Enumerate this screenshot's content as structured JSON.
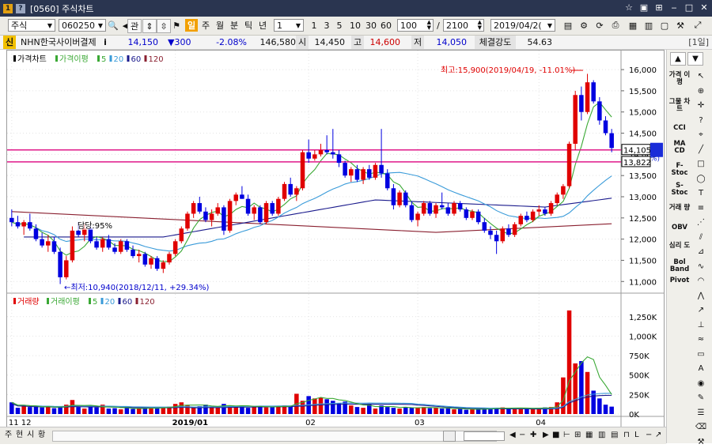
{
  "window": {
    "title": "[0560] 주식차트",
    "help_icon": "help-icon",
    "controls": [
      "fav-icon",
      "screen-icon",
      "link-icon",
      "minimize-icon",
      "maximize-icon",
      "close-icon"
    ]
  },
  "toolbar": {
    "market": "주식",
    "code": "060250",
    "buttons": [
      "관"
    ],
    "periods": [
      "일",
      "주",
      "월",
      "분",
      "틱",
      "년"
    ],
    "active_period": "일",
    "interval": "1",
    "quick_intervals": [
      "1",
      "3",
      "5",
      "10",
      "30",
      "60"
    ],
    "count": "100",
    "separator": "/",
    "total": "2100",
    "date": "2019/04/2("
  },
  "quote": {
    "badge": "신",
    "name": "NHN한국사이버결제",
    "info": "i",
    "price": "14,150",
    "change": "▼300",
    "change_pct": "-2.08%",
    "volume": "146,580",
    "open_label": "시",
    "open": "14,450",
    "high_label": "고",
    "high": "14,600",
    "low_label": "저",
    "low": "14,050",
    "strength_label": "체결강도",
    "strength": "54.63",
    "period_tag": "[1일]"
  },
  "price_legend": {
    "main": "가격차트",
    "ma": "가격이평",
    "p5": "5",
    "p20": "20",
    "p60": "60",
    "p120": "120"
  },
  "volume_legend": {
    "main": "거래량",
    "ma": "거래이평",
    "p5": "5",
    "p20": "20",
    "p60": "60",
    "p120": "120"
  },
  "annotations": {
    "max_label": "최고:15,900(2019/04/19, -11.01%)",
    "min_label": "최저:10,940(2018/12/11, +29.34%)",
    "mid_label": "담당:95%",
    "price_tag1": "14,105",
    "price_tag2": "13,822",
    "price_tag_extra": "%)"
  },
  "colors": {
    "up": "#e00000",
    "down": "#0000e0",
    "ma5": "#3aa834",
    "ma20": "#3a9bd9",
    "ma60": "#1a1a8c",
    "ma120": "#8a2030",
    "hline": "#e0188a"
  },
  "right_tools": {
    "labels": [
      "가격 이평",
      "그물 차트",
      "CCI",
      "MA CD",
      "F- Stoc",
      "S- Stoc",
      "거래 량",
      "OBV",
      "심리 도",
      "Bol Band",
      "Pivot"
    ]
  },
  "bottom": {
    "tabs": [
      "주",
      "현",
      "시",
      "황"
    ]
  },
  "chart_data": [
    {
      "type": "candlestick",
      "title": "가격차트",
      "x_axis_labels": [
        "11 12",
        "2019/01",
        "02",
        "03",
        "04"
      ],
      "y_ticks": [
        "16,000",
        "15,500",
        "15,000",
        "14,500",
        "14,000",
        "13,500",
        "13,000",
        "12,500",
        "12,000",
        "11,500",
        "11,000"
      ],
      "ylim": [
        10800,
        16300
      ],
      "horizontal_lines": [
        14105,
        13822
      ],
      "candles": [
        [
          12500,
          12700,
          12300,
          12400
        ],
        [
          12400,
          12550,
          12250,
          12300
        ],
        [
          12300,
          12450,
          12100,
          12400
        ],
        [
          12400,
          12600,
          12200,
          12250
        ],
        [
          12250,
          12350,
          11950,
          12000
        ],
        [
          12000,
          12150,
          11800,
          11850
        ],
        [
          11850,
          12100,
          11700,
          11950
        ],
        [
          11950,
          12050,
          11650,
          11700
        ],
        [
          11700,
          11800,
          10940,
          11100
        ],
        [
          11100,
          11600,
          11050,
          11500
        ],
        [
          11500,
          12300,
          11450,
          12200
        ],
        [
          12200,
          12400,
          12050,
          12100
        ],
        [
          12100,
          12350,
          11950,
          12250
        ],
        [
          12250,
          12300,
          11900,
          11950
        ],
        [
          11950,
          12050,
          11750,
          11800
        ],
        [
          11800,
          12050,
          11700,
          12000
        ],
        [
          12000,
          12100,
          11750,
          11800
        ],
        [
          11800,
          11900,
          11650,
          11700
        ],
        [
          11700,
          12000,
          11650,
          11950
        ],
        [
          11950,
          12000,
          11700,
          11750
        ],
        [
          11750,
          11850,
          11550,
          11600
        ],
        [
          11600,
          11750,
          11450,
          11650
        ],
        [
          11650,
          11700,
          11350,
          11400
        ],
        [
          11400,
          11600,
          11300,
          11550
        ],
        [
          11550,
          11600,
          11250,
          11300
        ],
        [
          11300,
          11500,
          11200,
          11450
        ],
        [
          11450,
          11700,
          11400,
          11650
        ],
        [
          11650,
          12000,
          11600,
          11950
        ],
        [
          11950,
          12300,
          11900,
          12250
        ],
        [
          12250,
          12650,
          12200,
          12600
        ],
        [
          12600,
          12900,
          12500,
          12850
        ],
        [
          12850,
          13000,
          12600,
          12650
        ],
        [
          12650,
          12750,
          12400,
          12450
        ],
        [
          12450,
          12700,
          12300,
          12600
        ],
        [
          12600,
          12850,
          12550,
          12750
        ],
        [
          12750,
          12800,
          12100,
          12200
        ],
        [
          12200,
          12950,
          12150,
          12900
        ],
        [
          12900,
          13100,
          12800,
          13050
        ],
        [
          13050,
          13250,
          12950,
          12950
        ],
        [
          12950,
          13050,
          12550,
          12600
        ],
        [
          12600,
          12800,
          12450,
          12750
        ],
        [
          12750,
          12800,
          12350,
          12400
        ],
        [
          12400,
          12900,
          12350,
          12850
        ],
        [
          12850,
          12900,
          12550,
          12600
        ],
        [
          12600,
          13000,
          12550,
          12950
        ],
        [
          12950,
          13350,
          12900,
          13300
        ],
        [
          13300,
          13450,
          13000,
          13050
        ],
        [
          13050,
          13250,
          12900,
          13200
        ],
        [
          13200,
          14100,
          13150,
          14050
        ],
        [
          14050,
          14350,
          13800,
          13900
        ],
        [
          13900,
          14100,
          13850,
          14000
        ],
        [
          14000,
          14250,
          13950,
          14100
        ],
        [
          14100,
          14450,
          14000,
          14050
        ],
        [
          14050,
          14600,
          13900,
          14000
        ],
        [
          14000,
          14100,
          13700,
          13800
        ],
        [
          13800,
          13850,
          13450,
          13500
        ],
        [
          13500,
          13700,
          13350,
          13650
        ],
        [
          13650,
          13750,
          13350,
          13400
        ],
        [
          13400,
          13700,
          13300,
          13650
        ],
        [
          13650,
          13750,
          13400,
          13450
        ],
        [
          13450,
          13800,
          13400,
          13750
        ],
        [
          13750,
          14600,
          13450,
          13550
        ],
        [
          13550,
          13650,
          13150,
          13200
        ],
        [
          13200,
          13300,
          12700,
          12800
        ],
        [
          12800,
          13150,
          12750,
          13100
        ],
        [
          13100,
          13150,
          12750,
          12800
        ],
        [
          12800,
          12900,
          12400,
          12450
        ],
        [
          12450,
          12650,
          12300,
          12600
        ],
        [
          12600,
          12900,
          12550,
          12850
        ],
        [
          12850,
          12900,
          12550,
          12600
        ],
        [
          12600,
          12850,
          12500,
          12800
        ],
        [
          12800,
          13100,
          12700,
          12750
        ],
        [
          12750,
          12850,
          12550,
          12600
        ],
        [
          12600,
          12900,
          12550,
          12850
        ],
        [
          12850,
          12900,
          12650,
          12700
        ],
        [
          12700,
          12750,
          12450,
          12500
        ],
        [
          12500,
          12700,
          12450,
          12650
        ],
        [
          12650,
          12700,
          12350,
          12400
        ],
        [
          12400,
          12500,
          12150,
          12200
        ],
        [
          12200,
          12300,
          12000,
          12100
        ],
        [
          12100,
          12200,
          11650,
          11950
        ],
        [
          11950,
          12300,
          11900,
          12250
        ],
        [
          12250,
          12350,
          12050,
          12100
        ],
        [
          12100,
          12400,
          12050,
          12350
        ],
        [
          12350,
          12600,
          12300,
          12550
        ],
        [
          12550,
          12650,
          12400,
          12450
        ],
        [
          12450,
          12700,
          12400,
          12650
        ],
        [
          12650,
          12800,
          12550,
          12700
        ],
        [
          12700,
          12750,
          12550,
          12600
        ],
        [
          12600,
          12900,
          12550,
          12850
        ],
        [
          12850,
          13100,
          12800,
          13050
        ],
        [
          13050,
          13300,
          12950,
          13250
        ],
        [
          13250,
          14300,
          13200,
          14250
        ],
        [
          14250,
          15500,
          14100,
          15400
        ],
        [
          15400,
          15600,
          14800,
          15000
        ],
        [
          15000,
          15900,
          14950,
          15700
        ],
        [
          15700,
          15750,
          15200,
          15250
        ],
        [
          15250,
          15350,
          14700,
          14800
        ],
        [
          14800,
          14900,
          14450,
          14500
        ],
        [
          14500,
          14600,
          14050,
          14150
        ]
      ],
      "ma_series": [
        "ma5",
        "ma20",
        "ma60",
        "ma120"
      ]
    },
    {
      "type": "bar",
      "title": "거래량",
      "y_ticks": [
        "1,250K",
        "1,000K",
        "750K",
        "500K",
        "250K",
        "0K"
      ],
      "ylim": [
        0,
        1400000
      ],
      "values": [
        150000,
        80000,
        110000,
        90000,
        95000,
        85000,
        100000,
        75000,
        90000,
        120000,
        180000,
        90000,
        70000,
        100000,
        85000,
        120000,
        70000,
        75000,
        60000,
        90000,
        65000,
        70000,
        75000,
        80000,
        85000,
        90000,
        95000,
        130000,
        150000,
        110000,
        90000,
        100000,
        120000,
        95000,
        85000,
        130000,
        110000,
        100000,
        110000,
        80000,
        95000,
        105000,
        85000,
        90000,
        100000,
        110000,
        105000,
        260000,
        170000,
        230000,
        200000,
        210000,
        190000,
        170000,
        140000,
        160000,
        110000,
        90000,
        80000,
        130000,
        70000,
        110000,
        90000,
        80000,
        70000,
        90000,
        80000,
        85000,
        90000,
        75000,
        80000,
        70000,
        75000,
        60000,
        65000,
        55000,
        60000,
        70000,
        65000,
        75000,
        80000,
        85000,
        70000,
        75000,
        80000,
        75000,
        70000,
        80000,
        85000,
        90000,
        150000,
        470000,
        1330000,
        650000,
        680000,
        540000,
        300000,
        200000,
        120000,
        95000
      ],
      "ma_series": [
        "ma5",
        "ma20",
        "ma60",
        "ma120"
      ]
    }
  ]
}
